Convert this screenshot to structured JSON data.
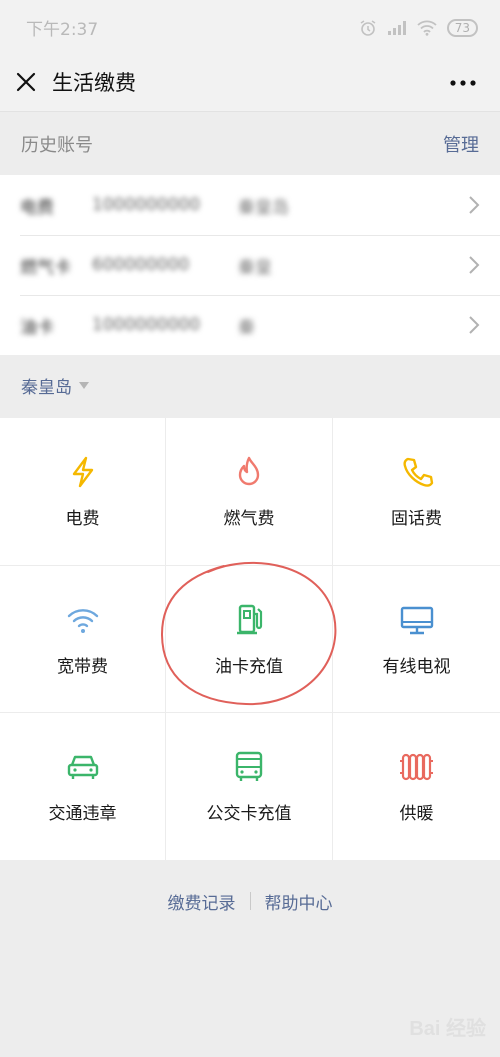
{
  "status_bar": {
    "time": "下午2:37",
    "battery": "73"
  },
  "nav": {
    "title": "生活缴费"
  },
  "history": {
    "title": "历史账号",
    "manage_label": "管理",
    "accounts": [
      {
        "name": "电费",
        "number": "1000000000",
        "location": "秦皇岛"
      },
      {
        "name": "燃气卡",
        "number": "600000000",
        "location": "秦皇"
      },
      {
        "name": "油卡",
        "number": "1000000000",
        "location": "秦"
      }
    ]
  },
  "city": {
    "label": "秦皇岛"
  },
  "services": [
    {
      "label": "电费",
      "icon": "lightning-icon",
      "color": "#f5b800"
    },
    {
      "label": "燃气费",
      "icon": "flame-icon",
      "color": "#f07a6e"
    },
    {
      "label": "固话费",
      "icon": "phone-icon",
      "color": "#f5b800"
    },
    {
      "label": "宽带费",
      "icon": "wifi-icon",
      "color": "#6ea8de"
    },
    {
      "label": "油卡充值",
      "icon": "fuel-pump-icon",
      "color": "#3bb56a"
    },
    {
      "label": "有线电视",
      "icon": "tv-icon",
      "color": "#4a90d0"
    },
    {
      "label": "交通违章",
      "icon": "car-icon",
      "color": "#3bb56a"
    },
    {
      "label": "公交卡充值",
      "icon": "bus-icon",
      "color": "#3bb56a"
    },
    {
      "label": "供暖",
      "icon": "radiator-icon",
      "color": "#e9695e"
    }
  ],
  "footer": {
    "records_label": "缴费记录",
    "help_label": "帮助中心"
  },
  "watermark": {
    "text": "Bai 经验"
  }
}
